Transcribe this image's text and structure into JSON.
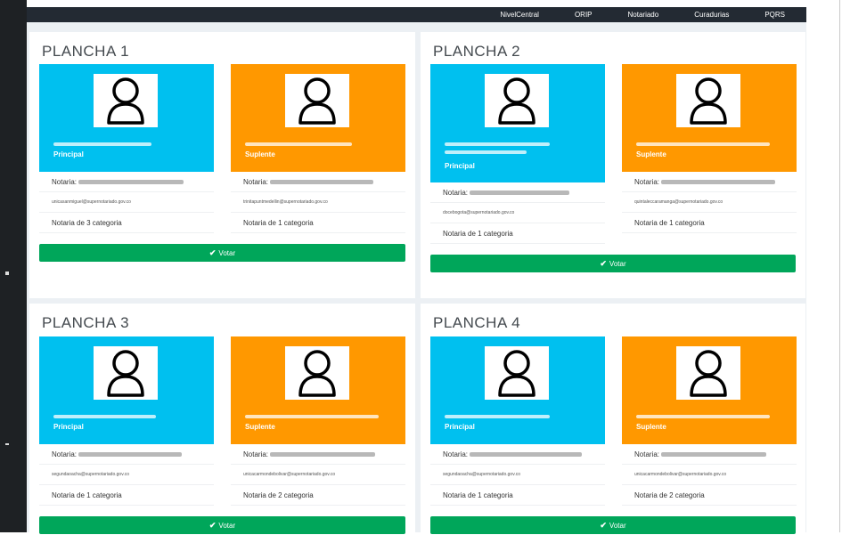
{
  "nav": {
    "items": [
      "NivelCentral",
      "ORIP",
      "Notariado",
      "Curadurias",
      "PQRS"
    ]
  },
  "icons": {
    "avatar": "user-silhouette-icon",
    "check": "check-icon"
  },
  "colors": {
    "principal": "#00c0ef",
    "suplente": "#ff9800",
    "vote_button": "#00a65a"
  },
  "vote_label": "Votar",
  "notaria_label": "Notaria:",
  "planchas": [
    {
      "title": "PLANCHA 1",
      "principal": {
        "role": "Principal",
        "email": "unicasanmiguel@supernotariado.gov.co",
        "category": "Notaria de 3 categoria"
      },
      "suplente": {
        "role": "Suplente",
        "email": "trinitapuntmedellin@supernotariado.gov.co",
        "category": "Notaria de 1 categoria"
      }
    },
    {
      "title": "PLANCHA 2",
      "principal": {
        "role": "Principal",
        "email": "docebogota@supernotariado.gov.co",
        "category": "Notaria de 1 categoria"
      },
      "suplente": {
        "role": "Suplente",
        "email": "quintaleccaramanga@supernotariado.gov.co",
        "category": "Notaria de 1 categoria"
      }
    },
    {
      "title": "PLANCHA 3",
      "principal": {
        "role": "Principal",
        "email": "segundaoacha@supernotariado.gov.co",
        "category": "Notaria de 1 categoria"
      },
      "suplente": {
        "role": "Suplente",
        "email": "unicacarmondebolivar@supernotariado.gov.co",
        "category": "Notaria de 2 categoria"
      }
    },
    {
      "title": "PLANCHA 4",
      "principal": {
        "role": "Principal",
        "email": "segundaoacha@supernotariado.gov.co",
        "category": "Notaria de 1 categoria"
      },
      "suplente": {
        "role": "Suplente",
        "email": "unicacarmondebolivar@supernotariado.gov.co",
        "category": "Notaria de 2 categoria"
      }
    }
  ]
}
